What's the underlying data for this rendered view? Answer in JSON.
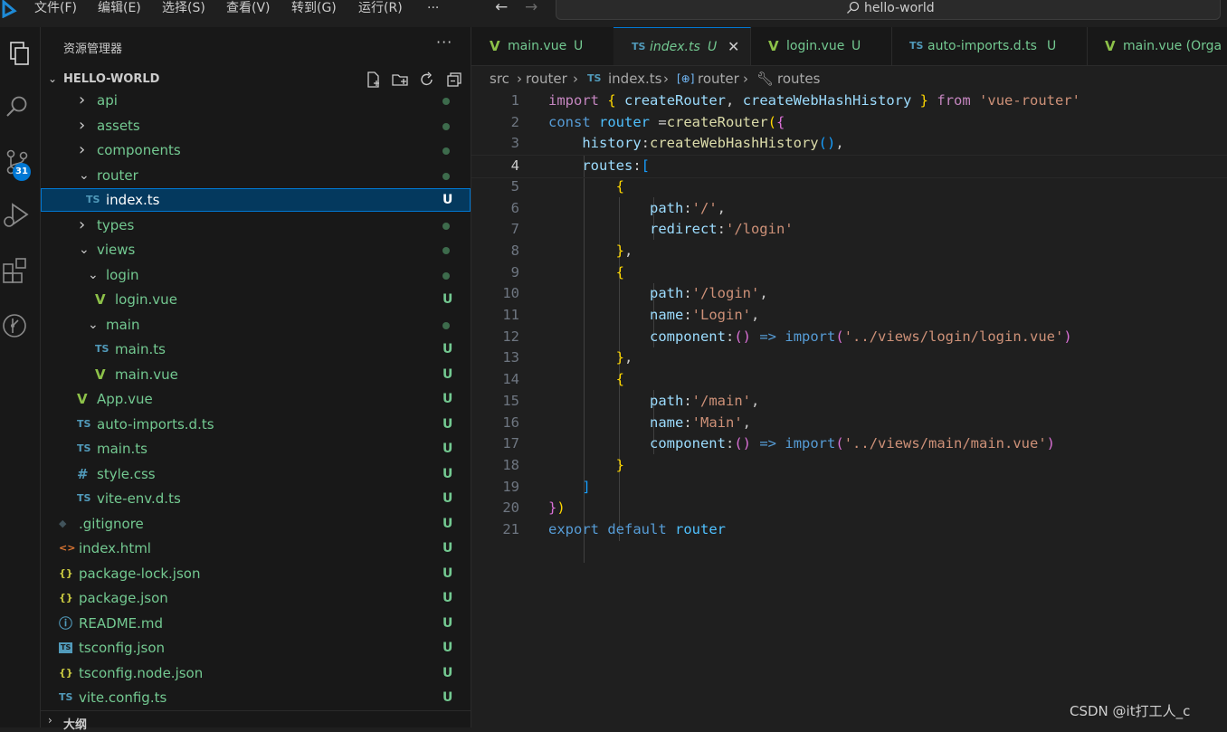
{
  "menu": [
    "文件(F)",
    "编辑(E)",
    "选择(S)",
    "查看(V)",
    "转到(G)",
    "运行(R)",
    "···"
  ],
  "search": {
    "text": "hello-world"
  },
  "activity": {
    "scm_badge": "31"
  },
  "explorer": {
    "title": "资源管理器",
    "more": "···",
    "section_title": "HELLO-WORLD",
    "outline_title": "大纲",
    "items": [
      {
        "label": "api",
        "type": "folder",
        "expanded": false,
        "depth": 1,
        "status": "dot"
      },
      {
        "label": "assets",
        "type": "folder",
        "expanded": false,
        "depth": 1,
        "status": "dot"
      },
      {
        "label": "components",
        "type": "folder",
        "expanded": false,
        "depth": 1,
        "status": "dot"
      },
      {
        "label": "router",
        "type": "folder",
        "expanded": true,
        "depth": 1,
        "status": "dot"
      },
      {
        "label": "index.ts",
        "type": "ts",
        "depth": 2,
        "status": "U",
        "selected": true
      },
      {
        "label": "types",
        "type": "folder",
        "expanded": false,
        "depth": 1,
        "status": "dot"
      },
      {
        "label": "views",
        "type": "folder",
        "expanded": true,
        "depth": 1,
        "status": "dot"
      },
      {
        "label": "login",
        "type": "folder",
        "expanded": true,
        "depth": 2,
        "status": "dot"
      },
      {
        "label": "login.vue",
        "type": "vue",
        "depth": 3,
        "status": "U"
      },
      {
        "label": "main",
        "type": "folder",
        "expanded": true,
        "depth": 2,
        "status": "dot"
      },
      {
        "label": "main.ts",
        "type": "ts",
        "depth": 3,
        "status": "U"
      },
      {
        "label": "main.vue",
        "type": "vue",
        "depth": 3,
        "status": "U"
      },
      {
        "label": "App.vue",
        "type": "vue",
        "depth": 1,
        "status": "U"
      },
      {
        "label": "auto-imports.d.ts",
        "type": "ts",
        "depth": 1,
        "status": "U"
      },
      {
        "label": "main.ts",
        "type": "ts",
        "depth": 1,
        "status": "U"
      },
      {
        "label": "style.css",
        "type": "css",
        "depth": 1,
        "status": "U"
      },
      {
        "label": "vite-env.d.ts",
        "type": "ts",
        "depth": 1,
        "status": "U"
      },
      {
        "label": ".gitignore",
        "type": "git",
        "depth": 0,
        "status": "U"
      },
      {
        "label": "index.html",
        "type": "html",
        "depth": 0,
        "status": "U"
      },
      {
        "label": "package-lock.json",
        "type": "json",
        "depth": 0,
        "status": "U"
      },
      {
        "label": "package.json",
        "type": "json",
        "depth": 0,
        "status": "U"
      },
      {
        "label": "README.md",
        "type": "info",
        "depth": 0,
        "status": "U"
      },
      {
        "label": "tsconfig.json",
        "type": "tsconfig",
        "depth": 0,
        "status": "U"
      },
      {
        "label": "tsconfig.node.json",
        "type": "json",
        "depth": 0,
        "status": "U"
      },
      {
        "label": "vite.config.ts",
        "type": "ts",
        "depth": 0,
        "status": "U"
      }
    ]
  },
  "tabs": [
    {
      "label": "main.vue",
      "type": "vue",
      "status": "U"
    },
    {
      "label": "index.ts",
      "type": "ts",
      "status": "U",
      "active": true
    },
    {
      "label": "login.vue",
      "type": "vue",
      "status": "U"
    },
    {
      "label": "auto-imports.d.ts",
      "type": "ts",
      "status": "U"
    },
    {
      "label": "main.vue (Orga",
      "type": "vue",
      "status": ""
    }
  ],
  "breadcrumb": [
    "src",
    "router",
    "index.ts",
    "router",
    "routes"
  ],
  "editor": {
    "current_line": 4,
    "lines": [
      [
        [
          "kw2",
          "import"
        ],
        [
          "pl",
          " "
        ],
        [
          "b1",
          "{"
        ],
        [
          "pl",
          " "
        ],
        [
          "prop",
          "createRouter"
        ],
        [
          "pl",
          ", "
        ],
        [
          "prop",
          "createWebHashHistory"
        ],
        [
          "pl",
          " "
        ],
        [
          "b1",
          "}"
        ],
        [
          "pl",
          " "
        ],
        [
          "kw2",
          "from"
        ],
        [
          "pl",
          " "
        ],
        [
          "str",
          "'vue-router'"
        ]
      ],
      [
        [
          "kw",
          "const"
        ],
        [
          "pl",
          " "
        ],
        [
          "var",
          "router"
        ],
        [
          "pl",
          " ="
        ],
        [
          "fn",
          "createRouter"
        ],
        [
          "b1",
          "("
        ],
        [
          "b2",
          "{"
        ]
      ],
      [
        [
          "pl",
          "    "
        ],
        [
          "prop",
          "history"
        ],
        [
          "pl",
          ":"
        ],
        [
          "fn",
          "createWebHashHistory"
        ],
        [
          "b3",
          "()"
        ],
        [
          "pl",
          ","
        ]
      ],
      [
        [
          "pl",
          "    "
        ],
        [
          "prop",
          "routes"
        ],
        [
          "pl",
          ":"
        ],
        [
          "b3",
          "["
        ]
      ],
      [
        [
          "pl",
          "        "
        ],
        [
          "b1",
          "{"
        ]
      ],
      [
        [
          "pl",
          "            "
        ],
        [
          "prop",
          "path"
        ],
        [
          "pl",
          ":"
        ],
        [
          "str",
          "'/'"
        ],
        [
          "pl",
          ","
        ]
      ],
      [
        [
          "pl",
          "            "
        ],
        [
          "prop",
          "redirect"
        ],
        [
          "pl",
          ":"
        ],
        [
          "str",
          "'/login'"
        ]
      ],
      [
        [
          "pl",
          "        "
        ],
        [
          "b1",
          "}"
        ],
        [
          "pl",
          ","
        ]
      ],
      [
        [
          "pl",
          "        "
        ],
        [
          "b1",
          "{"
        ]
      ],
      [
        [
          "pl",
          "            "
        ],
        [
          "prop",
          "path"
        ],
        [
          "pl",
          ":"
        ],
        [
          "str",
          "'/login'"
        ],
        [
          "pl",
          ","
        ]
      ],
      [
        [
          "pl",
          "            "
        ],
        [
          "prop",
          "name"
        ],
        [
          "pl",
          ":"
        ],
        [
          "str",
          "'Login'"
        ],
        [
          "pl",
          ","
        ]
      ],
      [
        [
          "pl",
          "            "
        ],
        [
          "prop",
          "component"
        ],
        [
          "pl",
          ":"
        ],
        [
          "b2",
          "()"
        ],
        [
          "pl",
          " "
        ],
        [
          "kw",
          "=>"
        ],
        [
          "pl",
          " "
        ],
        [
          "kw",
          "import"
        ],
        [
          "b2",
          "("
        ],
        [
          "str",
          "'../views/login/login.vue'"
        ],
        [
          "b2",
          ")"
        ]
      ],
      [
        [
          "pl",
          "        "
        ],
        [
          "b1",
          "}"
        ],
        [
          "pl",
          ","
        ]
      ],
      [
        [
          "pl",
          "        "
        ],
        [
          "b1",
          "{"
        ]
      ],
      [
        [
          "pl",
          "            "
        ],
        [
          "prop",
          "path"
        ],
        [
          "pl",
          ":"
        ],
        [
          "str",
          "'/main'"
        ],
        [
          "pl",
          ","
        ]
      ],
      [
        [
          "pl",
          "            "
        ],
        [
          "prop",
          "name"
        ],
        [
          "pl",
          ":"
        ],
        [
          "str",
          "'Main'"
        ],
        [
          "pl",
          ","
        ]
      ],
      [
        [
          "pl",
          "            "
        ],
        [
          "prop",
          "component"
        ],
        [
          "pl",
          ":"
        ],
        [
          "b2",
          "()"
        ],
        [
          "pl",
          " "
        ],
        [
          "kw",
          "=>"
        ],
        [
          "pl",
          " "
        ],
        [
          "kw",
          "import"
        ],
        [
          "b2",
          "("
        ],
        [
          "str",
          "'../views/main/main.vue'"
        ],
        [
          "b2",
          ")"
        ]
      ],
      [
        [
          "pl",
          "        "
        ],
        [
          "b1",
          "}"
        ]
      ],
      [
        [
          "pl",
          "    "
        ],
        [
          "b3",
          "]"
        ]
      ],
      [
        [
          "b2",
          "}"
        ],
        [
          "b1",
          ")"
        ]
      ],
      [
        [
          "kw",
          "export"
        ],
        [
          "pl",
          " "
        ],
        [
          "kw",
          "default"
        ],
        [
          "pl",
          " "
        ],
        [
          "var",
          "router"
        ]
      ]
    ]
  },
  "watermark": "CSDN @it打工人_c"
}
